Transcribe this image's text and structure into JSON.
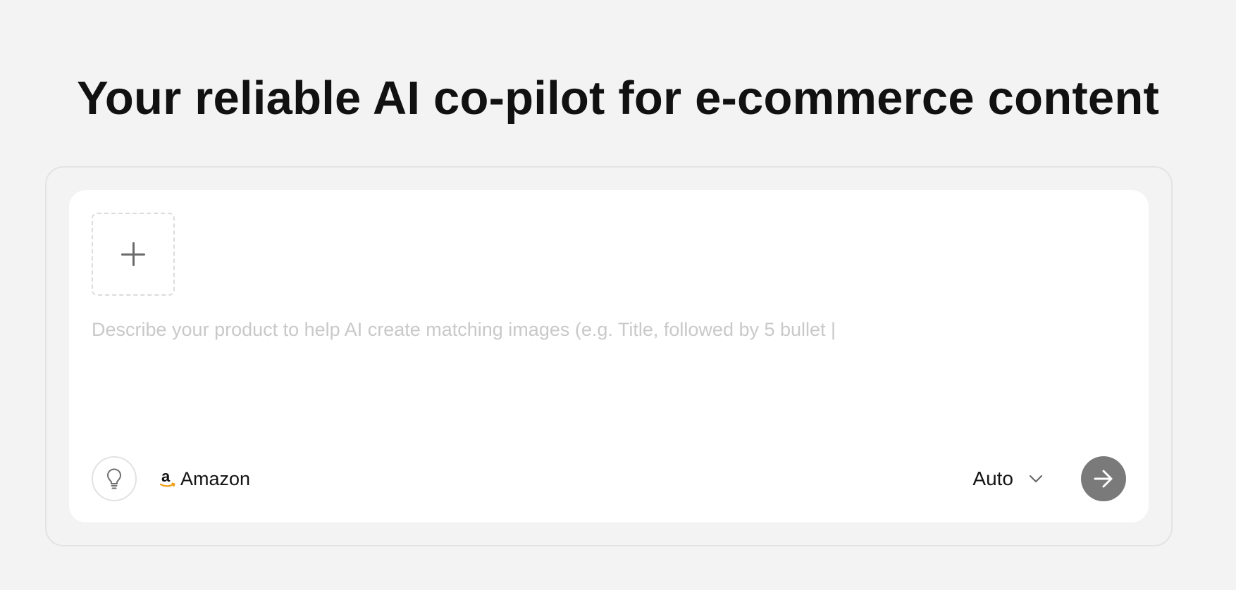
{
  "header": {
    "title": "Your reliable AI co-pilot for e-commerce content"
  },
  "composer": {
    "upload_icon": "plus-icon",
    "description": {
      "value": "",
      "placeholder": "Describe your product to help AI create matching images (e.g. Title, followed by 5 bullet |"
    },
    "idea_icon": "lightbulb-icon",
    "platform": {
      "icon": "amazon-logo-icon",
      "label": "Amazon"
    },
    "mode": {
      "selected": "Auto",
      "icon": "chevron-down-icon"
    },
    "send_icon": "arrow-right-icon"
  },
  "colors": {
    "background": "#f3f3f3",
    "card": "#ffffff",
    "send_button": "#7a7a7a",
    "amazon_orange": "#f39c12"
  }
}
